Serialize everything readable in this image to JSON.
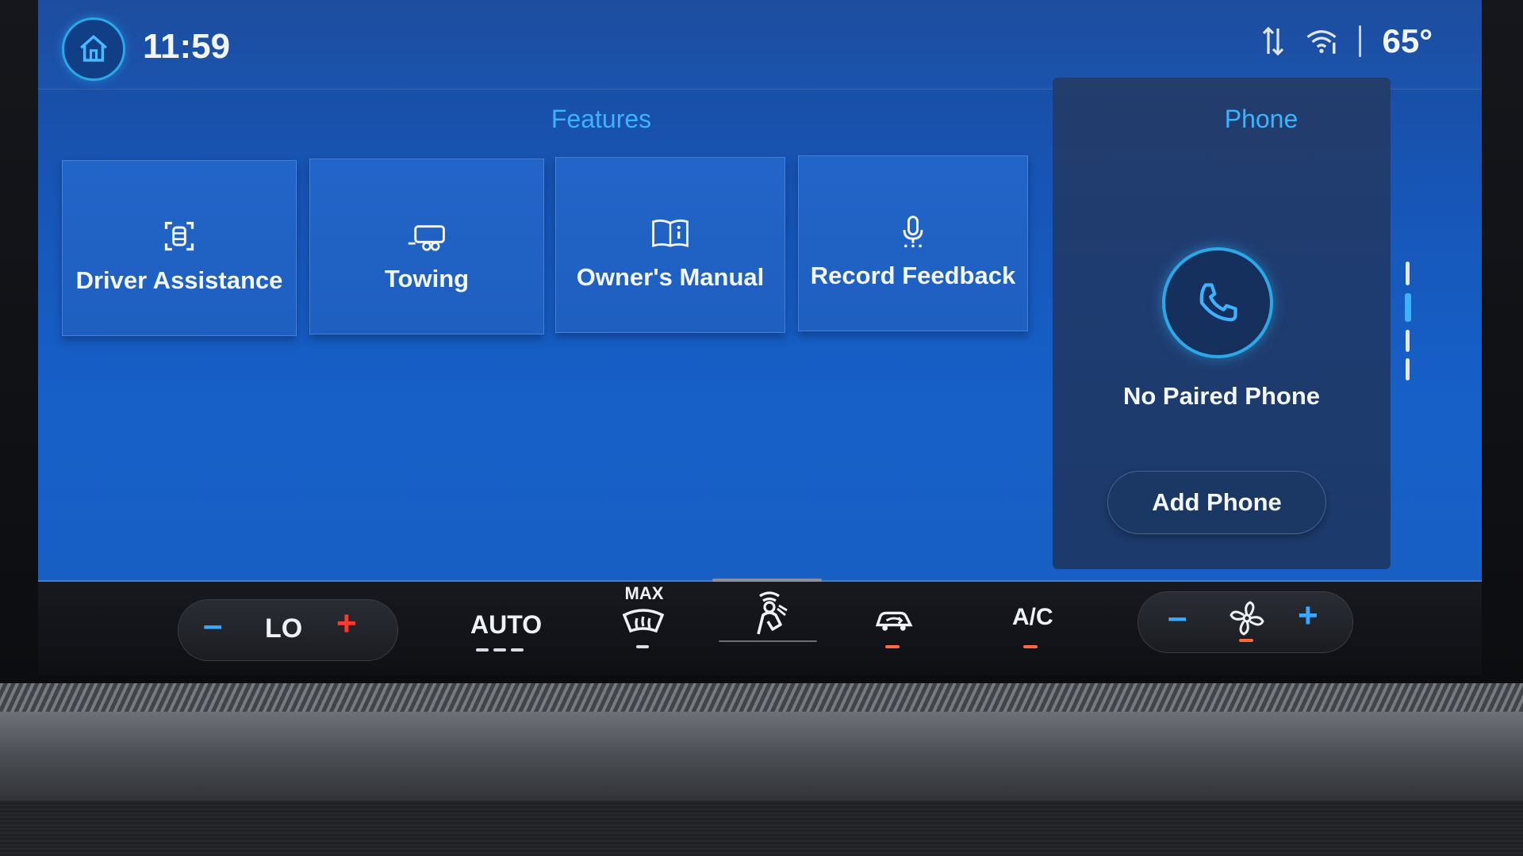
{
  "status_bar": {
    "time": "11:59",
    "outside_temp": "65°",
    "icons": [
      "home-icon",
      "data-transfer-icon",
      "wifi-icon"
    ]
  },
  "features": {
    "title": "Features",
    "tiles": [
      {
        "label": "Driver Assistance",
        "icon": "driver-assist-icon"
      },
      {
        "label": "Towing",
        "icon": "trailer-icon"
      },
      {
        "label": "Owner's Manual",
        "icon": "manual-book-icon"
      },
      {
        "label": "Record Feedback",
        "icon": "microphone-icon"
      }
    ]
  },
  "phone": {
    "title": "Phone",
    "status": "No Paired Phone",
    "add_button": "Add Phone"
  },
  "climate": {
    "temp_setting": "LO",
    "auto_label": "AUTO",
    "max_label": "MAX",
    "ac_label": "A/C"
  },
  "colors": {
    "accent": "#3db2ff",
    "screen_blue": "#1660c8",
    "climate_indicator": "#ff6a3d"
  }
}
